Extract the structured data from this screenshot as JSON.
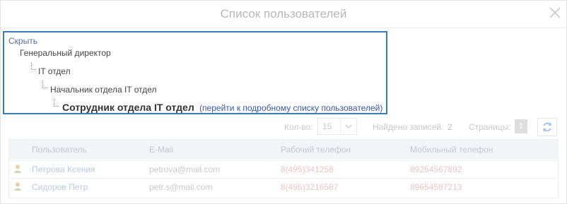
{
  "dialog": {
    "title": "Список пользователей"
  },
  "tree": {
    "hide_label": "Скрыть",
    "levels": [
      "Генеральный директор",
      "IT отдел",
      "Начальник отдела IT отдел"
    ],
    "current": "Сотрудник отдела IT отдел",
    "details_link": "(перейти к подробному списку пользователей)"
  },
  "toolbar": {
    "count_label": "Кол-во:",
    "count_value": "15",
    "found_label": "Найдено записей:",
    "found_value": "2",
    "pages_label": "Страницы:",
    "current_page": "1"
  },
  "table": {
    "columns": [
      "Пользователь",
      "E-Mail",
      "Рабочий телефон",
      "Мобильный телефон"
    ],
    "rows": [
      {
        "name": "Петрова Ксения",
        "email": "petrova@mail.com",
        "work_phone": "8(495)341258",
        "mobile": "89254567892"
      },
      {
        "name": "Сидоров Петр",
        "email": "petr.s@mail.com",
        "work_phone": "8(495)3216587",
        "mobile": "89654587213"
      }
    ]
  }
}
